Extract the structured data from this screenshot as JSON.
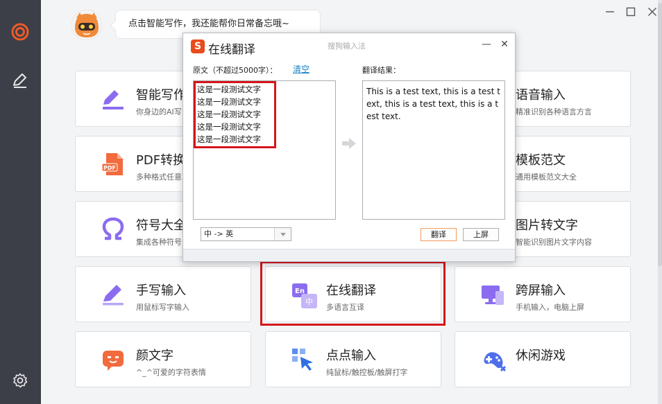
{
  "assistant": {
    "message": "点击智能写作，我还能帮你日常备忘哦~"
  },
  "cards": [
    {
      "title": "智能写作",
      "subtitle": "你身边的AI写",
      "icon": "pen-icon"
    },
    {
      "title": "语音输入",
      "subtitle": "精准识别各种语言方言",
      "icon": "microphone-icon"
    },
    {
      "title": "PDF转换",
      "subtitle": "多种格式任意",
      "icon": "pdf-icon"
    },
    {
      "title": "模板范文",
      "subtitle": "通用模板范文大全",
      "icon": "template-icon"
    },
    {
      "title": "符号大全",
      "subtitle": "集成各种符号",
      "icon": "omega-icon"
    },
    {
      "title": "图片转文字",
      "subtitle": "智能识别图片文字内容",
      "icon": "image-text-icon"
    },
    {
      "title": "手写输入",
      "subtitle": "用鼠标写字输入",
      "icon": "handwriting-icon"
    },
    {
      "title": "在线翻译",
      "subtitle": "多语言互译",
      "icon": "translate-icon"
    },
    {
      "title": "跨屏输入",
      "subtitle": "手机输入，电脑上屏",
      "icon": "cross-screen-icon"
    },
    {
      "title": "颜文字",
      "subtitle": "^_^可爱的字符表情",
      "icon": "emoticon-icon"
    },
    {
      "title": "点点输入",
      "subtitle": "纯鼠标/触控板/触屏打字",
      "icon": "click-input-icon"
    },
    {
      "title": "休闲游戏",
      "subtitle": "",
      "icon": "gamepad-icon"
    }
  ],
  "dialog": {
    "logo": "S",
    "title": "在线翻译",
    "brand": "搜狗输入法",
    "source_label": "原文（不超过5000字）：",
    "clear_label": "清空",
    "result_label": "翻译结果：",
    "source_lines": [
      "这是一段测试文字",
      "这是一段测试文字",
      "这是一段测试文字",
      "这是一段测试文字",
      "这是一段测试文字"
    ],
    "result_text": "This is a test text, this is a test text, this is a test text, this is a test text.",
    "language_pair": "中 -> 英",
    "translate_button": "翻译",
    "commit_button": "上屏",
    "minimize_glyph": "—",
    "close_glyph": "✕"
  },
  "colors": {
    "sidebar": "#3c3f47",
    "accent": "#f05a28",
    "highlight": "#d4161b",
    "icon_purple": "#8b6cf0",
    "icon_orange": "#f26a3d"
  }
}
